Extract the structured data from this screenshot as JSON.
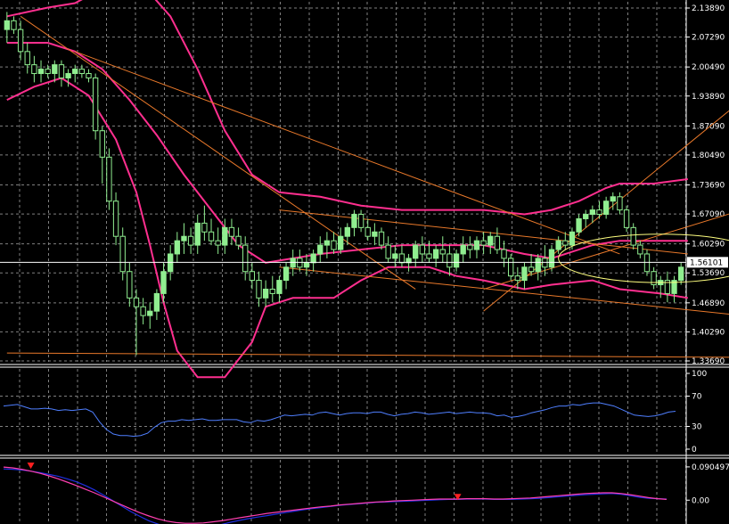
{
  "colors": {
    "background": "#000000",
    "grid": "#7f7f7f",
    "axis_text": "#ffffff",
    "bull_candle": "#90ee90",
    "bear_candle": "#000000",
    "bollinger": "#ff2f8f",
    "trendline": "#e8782a",
    "rsi_line": "#4f7fff",
    "macd_line": "#1f2fe0",
    "signal_line": "#ff3fb0",
    "arrow": "#ff2020",
    "annotation_circle": "#ffff80"
  },
  "chart_data": [
    {
      "panel": "price",
      "type": "candlestick",
      "ylim": [
        1.3369,
        2.1389
      ],
      "y_ticks": [
        "2.13890",
        "2.07290",
        "2.00490",
        "1.93890",
        "1.87090",
        "1.80490",
        "1.73690",
        "1.67090",
        "1.60290",
        "1.53690",
        "1.46890",
        "1.40290",
        "1.33690"
      ],
      "current_price": "1.56101",
      "grid": true,
      "ohlc": [
        [
          2.09,
          2.13,
          2.06,
          2.11
        ],
        [
          2.11,
          2.12,
          2.08,
          2.09
        ],
        [
          2.09,
          2.11,
          2.02,
          2.04
        ],
        [
          2.04,
          2.06,
          1.99,
          2.01
        ],
        [
          2.01,
          2.03,
          1.97,
          1.99
        ],
        [
          1.99,
          2.02,
          1.97,
          2.0
        ],
        [
          2.0,
          2.01,
          1.98,
          1.99
        ],
        [
          1.99,
          2.02,
          1.97,
          2.01
        ],
        [
          2.01,
          2.02,
          1.96,
          1.98
        ],
        [
          1.98,
          2.0,
          1.96,
          1.99
        ],
        [
          1.99,
          2.01,
          1.97,
          2.0
        ],
        [
          2.0,
          2.01,
          1.98,
          1.99
        ],
        [
          1.99,
          2.0,
          1.97,
          1.98
        ],
        [
          1.98,
          1.99,
          1.84,
          1.86
        ],
        [
          1.86,
          1.87,
          1.74,
          1.8
        ],
        [
          1.8,
          1.82,
          1.68,
          1.7
        ],
        [
          1.7,
          1.72,
          1.6,
          1.62
        ],
        [
          1.62,
          1.64,
          1.52,
          1.54
        ],
        [
          1.54,
          1.56,
          1.46,
          1.48
        ],
        [
          1.48,
          1.5,
          1.35,
          1.46
        ],
        [
          1.46,
          1.48,
          1.42,
          1.44
        ],
        [
          1.44,
          1.47,
          1.41,
          1.45
        ],
        [
          1.45,
          1.5,
          1.43,
          1.49
        ],
        [
          1.49,
          1.56,
          1.47,
          1.54
        ],
        [
          1.54,
          1.6,
          1.52,
          1.58
        ],
        [
          1.58,
          1.63,
          1.56,
          1.61
        ],
        [
          1.61,
          1.65,
          1.58,
          1.62
        ],
        [
          1.62,
          1.64,
          1.58,
          1.6
        ],
        [
          1.6,
          1.67,
          1.58,
          1.65
        ],
        [
          1.65,
          1.69,
          1.61,
          1.63
        ],
        [
          1.63,
          1.66,
          1.6,
          1.61
        ],
        [
          1.61,
          1.64,
          1.58,
          1.6
        ],
        [
          1.6,
          1.66,
          1.58,
          1.64
        ],
        [
          1.64,
          1.66,
          1.6,
          1.62
        ],
        [
          1.62,
          1.64,
          1.59,
          1.6
        ],
        [
          1.6,
          1.62,
          1.52,
          1.54
        ],
        [
          1.54,
          1.56,
          1.5,
          1.52
        ],
        [
          1.52,
          1.54,
          1.46,
          1.48
        ],
        [
          1.48,
          1.52,
          1.46,
          1.5
        ],
        [
          1.5,
          1.53,
          1.47,
          1.49
        ],
        [
          1.49,
          1.53,
          1.47,
          1.52
        ],
        [
          1.52,
          1.56,
          1.5,
          1.55
        ],
        [
          1.55,
          1.59,
          1.53,
          1.57
        ],
        [
          1.57,
          1.59,
          1.54,
          1.55
        ],
        [
          1.55,
          1.58,
          1.53,
          1.56
        ],
        [
          1.56,
          1.59,
          1.54,
          1.58
        ],
        [
          1.58,
          1.62,
          1.56,
          1.6
        ],
        [
          1.6,
          1.63,
          1.57,
          1.61
        ],
        [
          1.61,
          1.63,
          1.58,
          1.59
        ],
        [
          1.59,
          1.64,
          1.58,
          1.62
        ],
        [
          1.62,
          1.65,
          1.6,
          1.64
        ],
        [
          1.64,
          1.68,
          1.62,
          1.67
        ],
        [
          1.67,
          1.68,
          1.63,
          1.64
        ],
        [
          1.64,
          1.66,
          1.61,
          1.62
        ],
        [
          1.62,
          1.65,
          1.6,
          1.63
        ],
        [
          1.63,
          1.64,
          1.59,
          1.6
        ],
        [
          1.6,
          1.62,
          1.56,
          1.57
        ],
        [
          1.57,
          1.6,
          1.55,
          1.58
        ],
        [
          1.58,
          1.6,
          1.55,
          1.56
        ],
        [
          1.56,
          1.58,
          1.54,
          1.57
        ],
        [
          1.57,
          1.61,
          1.55,
          1.6
        ],
        [
          1.6,
          1.62,
          1.56,
          1.58
        ],
        [
          1.58,
          1.61,
          1.56,
          1.57
        ],
        [
          1.57,
          1.6,
          1.55,
          1.59
        ],
        [
          1.59,
          1.62,
          1.56,
          1.58
        ],
        [
          1.58,
          1.6,
          1.53,
          1.55
        ],
        [
          1.55,
          1.59,
          1.54,
          1.58
        ],
        [
          1.58,
          1.62,
          1.56,
          1.6
        ],
        [
          1.6,
          1.62,
          1.57,
          1.59
        ],
        [
          1.59,
          1.62,
          1.57,
          1.61
        ],
        [
          1.61,
          1.63,
          1.58,
          1.6
        ],
        [
          1.6,
          1.63,
          1.58,
          1.62
        ],
        [
          1.62,
          1.64,
          1.58,
          1.59
        ],
        [
          1.59,
          1.61,
          1.55,
          1.57
        ],
        [
          1.57,
          1.58,
          1.52,
          1.53
        ],
        [
          1.53,
          1.55,
          1.5,
          1.52
        ],
        [
          1.52,
          1.56,
          1.5,
          1.55
        ],
        [
          1.55,
          1.58,
          1.53,
          1.54
        ],
        [
          1.54,
          1.58,
          1.52,
          1.57
        ],
        [
          1.57,
          1.6,
          1.53,
          1.55
        ],
        [
          1.55,
          1.6,
          1.54,
          1.59
        ],
        [
          1.59,
          1.62,
          1.58,
          1.61
        ],
        [
          1.61,
          1.63,
          1.59,
          1.6
        ],
        [
          1.6,
          1.64,
          1.59,
          1.63
        ],
        [
          1.63,
          1.67,
          1.62,
          1.66
        ],
        [
          1.66,
          1.68,
          1.64,
          1.67
        ],
        [
          1.67,
          1.69,
          1.65,
          1.68
        ],
        [
          1.68,
          1.7,
          1.66,
          1.67
        ],
        [
          1.67,
          1.71,
          1.66,
          1.7
        ],
        [
          1.7,
          1.72,
          1.68,
          1.71
        ],
        [
          1.71,
          1.72,
          1.67,
          1.68
        ],
        [
          1.68,
          1.69,
          1.63,
          1.64
        ],
        [
          1.64,
          1.65,
          1.59,
          1.6
        ],
        [
          1.6,
          1.61,
          1.57,
          1.58
        ],
        [
          1.58,
          1.59,
          1.53,
          1.54
        ],
        [
          1.54,
          1.55,
          1.5,
          1.51
        ],
        [
          1.51,
          1.53,
          1.48,
          1.52
        ],
        [
          1.52,
          1.54,
          1.47,
          1.49
        ],
        [
          1.49,
          1.53,
          1.47,
          1.52
        ],
        [
          1.52,
          1.56,
          1.51,
          1.55
        ]
      ],
      "bollinger": {
        "upper": [
          [
            0,
            2.12
          ],
          [
            6,
            2.14
          ],
          [
            10,
            2.15
          ],
          [
            16,
            2.2
          ],
          [
            20,
            2.19
          ],
          [
            24,
            2.12
          ],
          [
            28,
            2.0
          ],
          [
            32,
            1.86
          ],
          [
            36,
            1.76
          ],
          [
            40,
            1.72
          ],
          [
            46,
            1.71
          ],
          [
            52,
            1.69
          ],
          [
            58,
            1.68
          ],
          [
            64,
            1.68
          ],
          [
            70,
            1.68
          ],
          [
            76,
            1.67
          ],
          [
            80,
            1.68
          ],
          [
            84,
            1.7
          ],
          [
            88,
            1.73
          ],
          [
            90,
            1.74
          ],
          [
            95,
            1.74
          ],
          [
            100,
            1.75
          ]
        ],
        "middle": [
          [
            0,
            2.06
          ],
          [
            6,
            2.06
          ],
          [
            10,
            2.04
          ],
          [
            14,
            2.0
          ],
          [
            18,
            1.93
          ],
          [
            22,
            1.85
          ],
          [
            26,
            1.76
          ],
          [
            30,
            1.68
          ],
          [
            34,
            1.6
          ],
          [
            38,
            1.56
          ],
          [
            42,
            1.57
          ],
          [
            46,
            1.58
          ],
          [
            52,
            1.59
          ],
          [
            58,
            1.6
          ],
          [
            64,
            1.6
          ],
          [
            70,
            1.6
          ],
          [
            76,
            1.58
          ],
          [
            80,
            1.57
          ],
          [
            86,
            1.6
          ],
          [
            90,
            1.61
          ],
          [
            95,
            1.61
          ],
          [
            100,
            1.61
          ]
        ],
        "lower": [
          [
            0,
            1.93
          ],
          [
            4,
            1.96
          ],
          [
            8,
            1.98
          ],
          [
            12,
            1.94
          ],
          [
            16,
            1.84
          ],
          [
            19,
            1.72
          ],
          [
            21,
            1.6
          ],
          [
            23,
            1.47
          ],
          [
            25,
            1.36
          ],
          [
            28,
            1.3
          ],
          [
            32,
            1.3
          ],
          [
            36,
            1.38
          ],
          [
            38,
            1.46
          ],
          [
            42,
            1.48
          ],
          [
            48,
            1.48
          ],
          [
            52,
            1.52
          ],
          [
            56,
            1.55
          ],
          [
            62,
            1.55
          ],
          [
            66,
            1.53
          ],
          [
            70,
            1.52
          ],
          [
            76,
            1.5
          ],
          [
            80,
            1.51
          ],
          [
            86,
            1.52
          ],
          [
            90,
            1.5
          ],
          [
            96,
            1.49
          ],
          [
            100,
            1.48
          ]
        ]
      },
      "trendlines": [
        {
          "from": [
            2,
            2.12
          ],
          "to": [
            60,
            1.5
          ]
        },
        {
          "from": [
            10,
            2.04
          ],
          "to": [
            90,
            1.58
          ]
        },
        {
          "from": [
            40,
            1.68
          ],
          "to": [
            100,
            1.58
          ]
        },
        {
          "from": [
            40,
            1.55
          ],
          "to": [
            108,
            1.44
          ]
        },
        {
          "from": [
            70,
            1.5
          ],
          "to": [
            108,
            1.68
          ]
        },
        {
          "from": [
            70,
            1.45
          ],
          "to": [
            108,
            1.93
          ]
        },
        {
          "from": [
            0,
            1.355
          ],
          "to": [
            108,
            1.345
          ]
        }
      ],
      "horizontal_lines": [
        {
          "level": 1.561,
          "color": "#ffffff"
        }
      ],
      "annotations": [
        {
          "type": "ellipse",
          "at": [
            96,
            1.57
          ],
          "rx": 2.5,
          "ry": 0.055
        }
      ]
    },
    {
      "panel": "oscillator",
      "type": "line",
      "ylim": [
        0,
        100
      ],
      "y_ticks": [
        "100",
        "70",
        "30",
        "0"
      ],
      "series": [
        {
          "values": [
            57,
            58,
            59,
            56,
            53,
            53,
            54,
            53,
            51,
            52,
            51,
            52,
            53,
            49,
            36,
            26,
            20,
            18,
            18,
            17,
            18,
            21,
            29,
            35,
            37,
            37,
            39,
            38,
            39,
            40,
            38,
            38,
            39,
            39,
            39,
            36,
            35,
            38,
            37,
            39,
            42,
            45,
            44,
            45,
            46,
            45,
            48,
            49,
            47,
            45,
            47,
            48,
            48,
            47,
            49,
            49,
            46,
            44,
            46,
            47,
            49,
            48,
            46,
            47,
            48,
            49,
            47,
            48,
            49,
            48,
            48,
            47,
            44,
            45,
            42,
            43,
            45,
            48,
            50,
            52,
            55,
            57,
            57,
            59,
            58,
            60,
            61,
            61,
            59,
            57,
            53,
            49,
            45,
            44,
            43,
            44,
            46,
            49,
            50
          ]
        }
      ]
    },
    {
      "panel": "macd",
      "type": "line",
      "ylim": [
        -0.06,
        0.1
      ],
      "y_ticks": [
        "0.090497",
        "0.00"
      ],
      "series": [
        {
          "values": [
            0.085,
            0.084,
            0.082,
            0.079,
            0.075,
            0.07,
            0.065,
            0.058,
            0.05,
            0.04,
            0.028,
            0.014,
            -0.001,
            -0.016,
            -0.031,
            -0.044,
            -0.056,
            -0.065,
            -0.072,
            -0.078,
            -0.08,
            -0.079,
            -0.076,
            -0.071,
            -0.066,
            -0.06,
            -0.055,
            -0.05,
            -0.046,
            -0.042,
            -0.038,
            -0.034,
            -0.03,
            -0.026,
            -0.023,
            -0.02,
            -0.017,
            -0.014,
            -0.012,
            -0.01,
            -0.008,
            -0.006,
            -0.005,
            -0.004,
            -0.003,
            -0.002,
            -0.001,
            0.0,
            0.001,
            0.002,
            0.002,
            0.003,
            0.003,
            0.003,
            0.002,
            0.002,
            0.002,
            0.003,
            0.004,
            0.005,
            0.007,
            0.009,
            0.011,
            0.013,
            0.015,
            0.016,
            0.017,
            0.018,
            0.016,
            0.012,
            0.008,
            0.005,
            0.004,
            0.003
          ]
        },
        {
          "values": [
            0.09,
            0.088,
            0.084,
            0.079,
            0.073,
            0.066,
            0.058,
            0.049,
            0.04,
            0.03,
            0.02,
            0.009,
            -0.002,
            -0.013,
            -0.024,
            -0.034,
            -0.043,
            -0.051,
            -0.057,
            -0.061,
            -0.063,
            -0.063,
            -0.062,
            -0.059,
            -0.056,
            -0.052,
            -0.048,
            -0.044,
            -0.04,
            -0.036,
            -0.033,
            -0.03,
            -0.027,
            -0.024,
            -0.021,
            -0.018,
            -0.016,
            -0.013,
            -0.011,
            -0.009,
            -0.007,
            -0.005,
            -0.004,
            -0.002,
            -0.001,
            0.0,
            0.001,
            0.002,
            0.003,
            0.003,
            0.003,
            0.004,
            0.004,
            0.004,
            0.003,
            0.003,
            0.004,
            0.005,
            0.006,
            0.008,
            0.01,
            0.012,
            0.014,
            0.016,
            0.018,
            0.019,
            0.02,
            0.02,
            0.018,
            0.015,
            0.011,
            0.007,
            0.004,
            0.002
          ]
        }
      ],
      "arrows": [
        {
          "at": [
            3,
            0.09
          ]
        },
        {
          "at": [
            50,
            0.005
          ]
        }
      ]
    }
  ]
}
